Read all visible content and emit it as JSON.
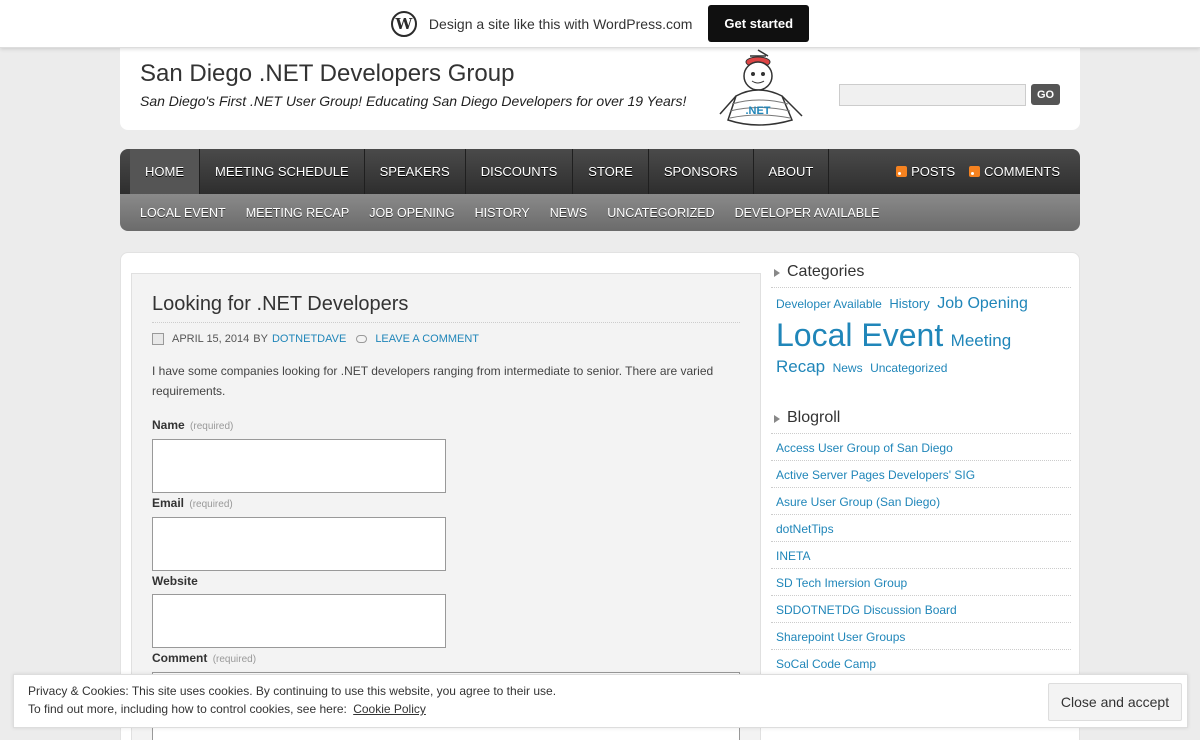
{
  "wp_bar": {
    "text": "Design a site like this with WordPress.com",
    "button": "Get started",
    "logo_icon": "wordpress-logo-icon"
  },
  "header": {
    "title": "San Diego .NET Developers Group",
    "description": "San Diego's First .NET User Group! Educating San Diego Developers for over 19 Years!",
    "mascot_label": ".NET",
    "search_placeholder": "",
    "search_button": "GO"
  },
  "nav": {
    "items": [
      {
        "label": "HOME"
      },
      {
        "label": "MEETING SCHEDULE"
      },
      {
        "label": "SPEAKERS"
      },
      {
        "label": "DISCOUNTS"
      },
      {
        "label": "STORE"
      },
      {
        "label": "SPONSORS"
      },
      {
        "label": "ABOUT"
      }
    ],
    "feeds": {
      "posts": "POSTS",
      "comments": "COMMENTS"
    },
    "subitems": [
      {
        "label": "LOCAL EVENT"
      },
      {
        "label": "MEETING RECAP"
      },
      {
        "label": "JOB OPENING"
      },
      {
        "label": "HISTORY"
      },
      {
        "label": "NEWS"
      },
      {
        "label": "UNCATEGORIZED"
      },
      {
        "label": "DEVELOPER AVAILABLE"
      }
    ]
  },
  "post": {
    "title": "Looking for .NET Developers",
    "date": "APRIL 15, 2014",
    "by": "BY",
    "author": "DOTNETDAVE",
    "comment_link": "LEAVE A COMMENT",
    "body": "I have some companies looking for .NET developers ranging from intermediate to senior. There are varied requirements.",
    "form": {
      "name_label": "Name",
      "email_label": "Email",
      "website_label": "Website",
      "comment_label": "Comment",
      "required": "(required)"
    }
  },
  "sidebar": {
    "categories_title": "Categories",
    "tags": {
      "developer_available": "Developer Available",
      "history": "History",
      "job_opening": "Job Opening",
      "local_event": "Local Event",
      "meeting_recap": "Meeting Recap",
      "news": "News",
      "uncategorized": "Uncategorized"
    },
    "blogroll_title": "Blogroll",
    "blogroll": [
      "Access User Group of San Diego",
      "Active Server Pages Developers' SIG",
      "Asure User Group (San Diego)",
      "dotNetTips",
      "INETA",
      "SD Tech Imersion Group",
      "SDDOTNETDG Discussion Board",
      "Sharepoint User Groups",
      "SoCal Code Camp"
    ]
  },
  "cookie": {
    "line1": "Privacy & Cookies: This site uses cookies. By continuing to use this website, you agree to their use.",
    "line2": "To find out more, including how to control cookies, see here:",
    "link": "Cookie Policy",
    "button": "Close and accept"
  },
  "colors": {
    "link": "#2086b9",
    "nav_dark": "#333333",
    "background": "#ececec"
  }
}
